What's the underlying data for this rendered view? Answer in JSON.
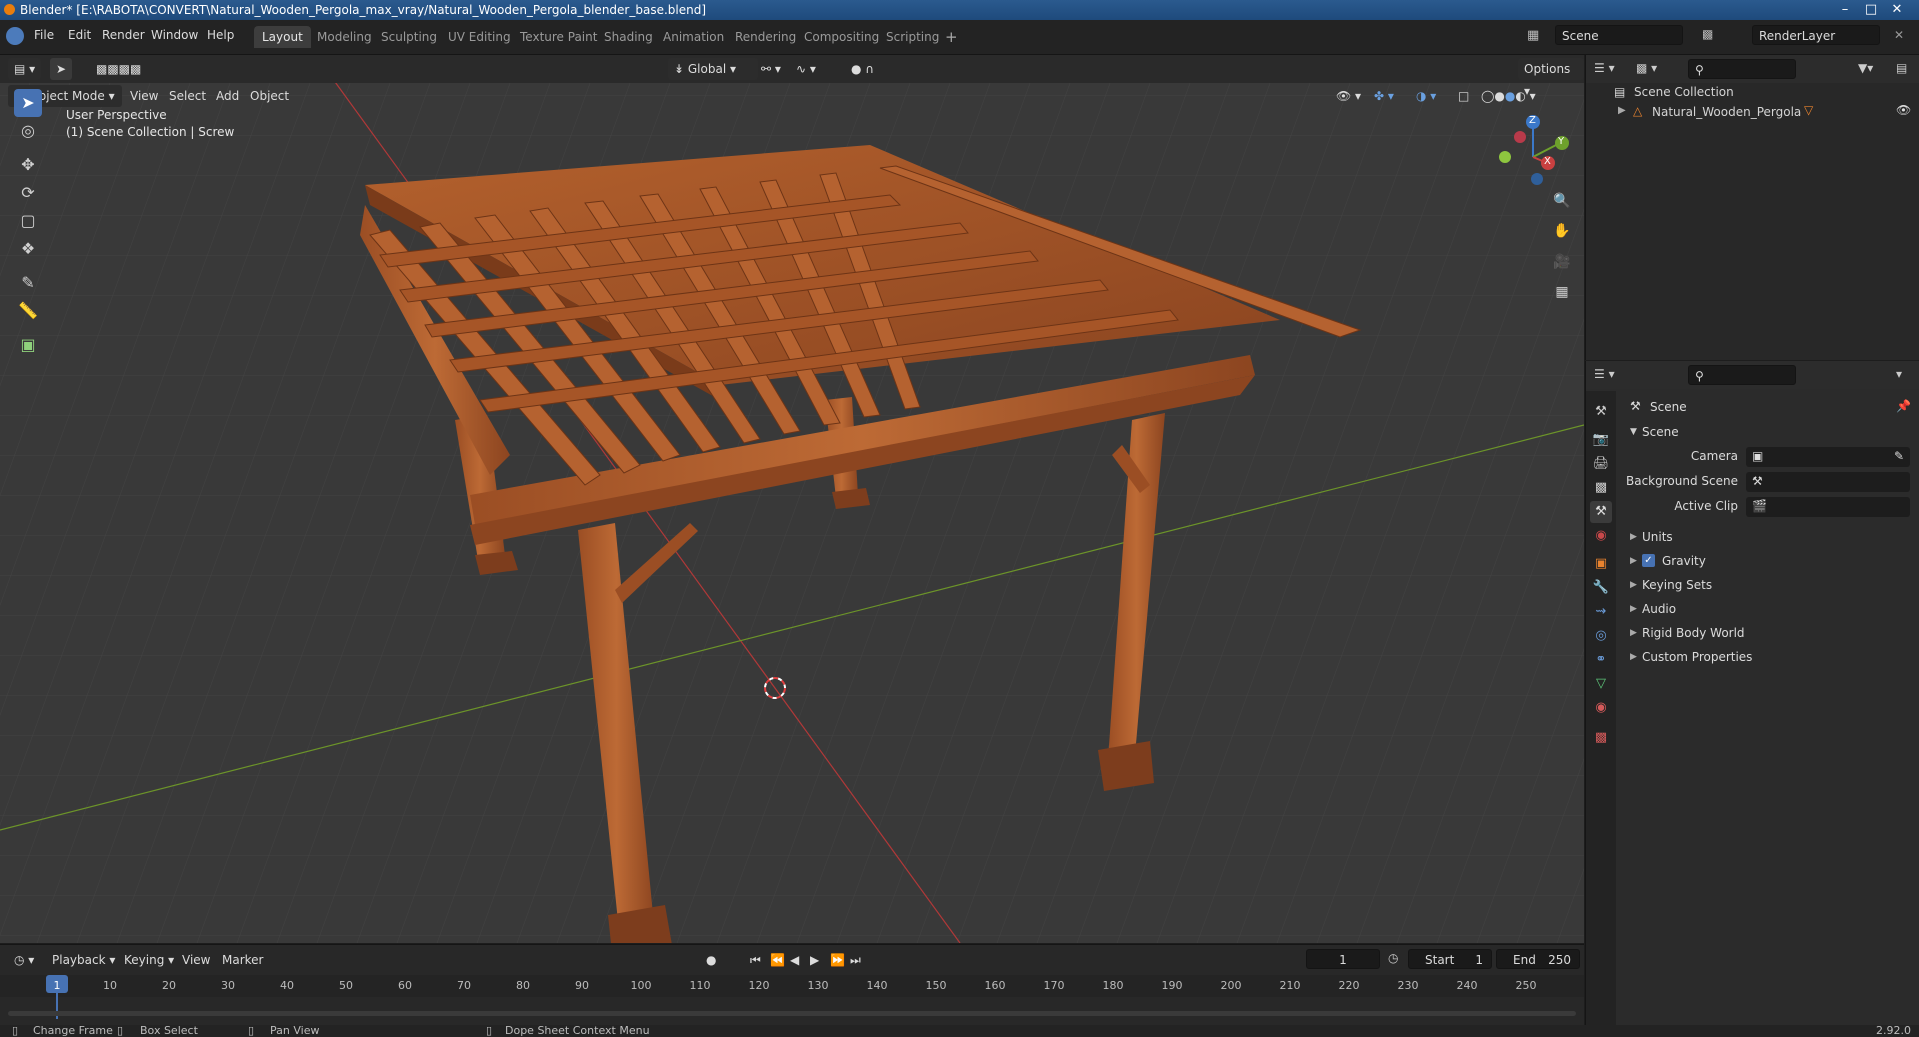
{
  "window": {
    "title": "Blender* [E:\\RABOTA\\CONVERT\\Natural_Wooden_Pergola_max_vray/Natural_Wooden_Pergola_blender_base.blend]"
  },
  "menu": {
    "file": "File",
    "edit": "Edit",
    "render": "Render",
    "window": "Window",
    "help": "Help"
  },
  "workspaces": [
    "Layout",
    "Modeling",
    "Sculpting",
    "UV Editing",
    "Texture Paint",
    "Shading",
    "Animation",
    "Rendering",
    "Compositing",
    "Scripting"
  ],
  "scene": {
    "name": "Scene",
    "render_layer": "RenderLayer"
  },
  "viewport": {
    "transform_orientation": "Global",
    "options_label": "Options",
    "mode": "Object Mode",
    "menus": {
      "view": "View",
      "select": "Select",
      "add": "Add",
      "object": "Object"
    },
    "overlay_line1": "User Perspective",
    "overlay_line2": "(1) Scene Collection | Screw",
    "gizmo": {
      "x": "X",
      "y": "Y",
      "z": "Z"
    }
  },
  "outliner": {
    "collection": "Scene Collection",
    "object": "Natural_Wooden_Pergola"
  },
  "properties": {
    "header": "Scene",
    "section": "Scene",
    "camera_label": "Camera",
    "background_scene_label": "Background Scene",
    "active_clip_label": "Active Clip",
    "panels": [
      "Units",
      "Gravity",
      "Keying Sets",
      "Audio",
      "Rigid Body World",
      "Custom Properties"
    ]
  },
  "timeline": {
    "menus": {
      "playback": "Playback",
      "keying": "Keying",
      "view": "View",
      "marker": "Marker"
    },
    "current_frame": "1",
    "start_label": "Start",
    "start": "1",
    "end_label": "End",
    "end": "250",
    "ticks": [
      "1",
      "10",
      "20",
      "30",
      "40",
      "50",
      "60",
      "70",
      "80",
      "90",
      "100",
      "110",
      "120",
      "130",
      "140",
      "150",
      "160",
      "170",
      "180",
      "190",
      "200",
      "210",
      "220",
      "230",
      "240",
      "250"
    ]
  },
  "statusbar": {
    "change_frame": "Change Frame",
    "box_select": "Box Select",
    "pan_view": "Pan View",
    "context_menu": "Dope Sheet Context Menu",
    "version": "2.92.0"
  },
  "colors": {
    "accent": "#4772b3",
    "wood": "#a9572a",
    "x_axis": "#c03a3a",
    "y_axis": "#6f9a2a"
  }
}
